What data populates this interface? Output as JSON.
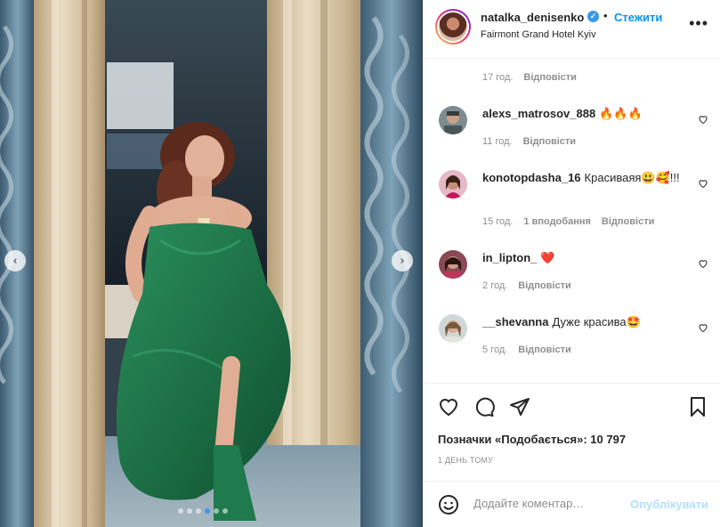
{
  "post": {
    "username": "natalka_denisenko",
    "verified_label": "✓",
    "separator": "•",
    "follow_label": "Стежити",
    "location": "Fairmont Grand Hotel Kyiv",
    "more_label": "•••"
  },
  "carousel": {
    "prev_label": "‹",
    "next_label": "›",
    "slide_count": 6,
    "active_slide": 3
  },
  "comments": [
    {
      "username": "",
      "text": "",
      "time": "17 год.",
      "likes": "",
      "reply_label": "Відповісти"
    },
    {
      "username": "alexs_matrosov_888",
      "text": "🔥🔥🔥",
      "time": "11 год.",
      "likes": "",
      "reply_label": "Відповісти"
    },
    {
      "username": "konotopdasha_16",
      "text": "Красиваяя😃🥰!!!",
      "time": "15 год.",
      "likes": "1 вподобання",
      "reply_label": "Відповісти"
    },
    {
      "username": "in_lipton_",
      "text": "❤️",
      "time": "2 год.",
      "likes": "",
      "reply_label": "Відповісти"
    },
    {
      "username": "__shevanna",
      "text": "Дуже красива🤩",
      "time": "5 год.",
      "likes": "",
      "reply_label": "Відповісти"
    }
  ],
  "likes_text": "Позначки «Подобається»: 10 797",
  "date_text": "1 ДЕНЬ ТОМУ",
  "composer": {
    "placeholder": "Додайте коментар…",
    "publish_label": "Опублікувати"
  },
  "colors": {
    "accent": "#0095f6",
    "muted": "#8e8e8e",
    "publish_disabled": "#b2dffc",
    "dress": "#1f7a4d"
  }
}
